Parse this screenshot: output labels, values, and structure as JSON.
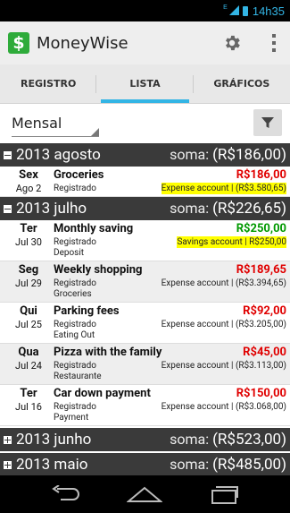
{
  "status": {
    "time": "14h35",
    "net": "E"
  },
  "app": {
    "title": "MoneyWise",
    "logo": "$"
  },
  "tabs": [
    {
      "label": "REGISTRO",
      "active": false
    },
    {
      "label": "LISTA",
      "active": true
    },
    {
      "label": "GRÁFICOS",
      "active": false
    }
  ],
  "filter": {
    "period": "Mensal"
  },
  "months": [
    {
      "title": "2013 agosto",
      "sum_label": "soma:",
      "sum": "(R$186,00)",
      "expanded": true,
      "items": [
        {
          "dow": "Sex",
          "date": "Ago 2",
          "desc": "Groceries",
          "amount": "R$186,00",
          "type": "neg",
          "status": "Registrado",
          "account": "Expense account | (R$3.580,65)",
          "highlight": true,
          "category": ""
        }
      ]
    },
    {
      "title": "2013 julho",
      "sum_label": "soma:",
      "sum": "(R$226,65)",
      "expanded": true,
      "items": [
        {
          "dow": "Ter",
          "date": "Jul 30",
          "desc": "Monthly saving",
          "amount": "R$250,00",
          "type": "pos",
          "status": "Registrado",
          "account": "Savings account | R$250,00",
          "highlight": true,
          "category": "Deposit"
        },
        {
          "dow": "Seg",
          "date": "Jul 29",
          "desc": "Weekly shopping",
          "amount": "R$189,65",
          "type": "neg",
          "status": "Registrado",
          "account": "Expense account | (R$3.394,65)",
          "highlight": false,
          "category": "Groceries"
        },
        {
          "dow": "Qui",
          "date": "Jul 25",
          "desc": "Parking fees",
          "amount": "R$92,00",
          "type": "neg",
          "status": "Registrado",
          "account": "Expense account | (R$3.205,00)",
          "highlight": false,
          "category": "Eating Out"
        },
        {
          "dow": "Qua",
          "date": "Jul 24",
          "desc": "Pizza with the family",
          "amount": "R$45,00",
          "type": "neg",
          "status": "Registrado",
          "account": "Expense account | (R$3.113,00)",
          "highlight": false,
          "category": "Restaurante"
        },
        {
          "dow": "Ter",
          "date": "Jul 16",
          "desc": "Car down payment",
          "amount": "R$150,00",
          "type": "neg",
          "status": "Registrado",
          "account": "Expense account | (R$3.068,00)",
          "highlight": false,
          "category": "Payment"
        }
      ]
    },
    {
      "title": "2013 junho",
      "sum_label": "soma:",
      "sum": "(R$523,00)",
      "expanded": false,
      "items": []
    },
    {
      "title": "2013 maio",
      "sum_label": "soma:",
      "sum": "(R$485,00)",
      "expanded": false,
      "items": []
    }
  ],
  "icons": {
    "settings": "gear-icon",
    "overflow": "overflow-menu-icon",
    "filter": "filter-funnel-icon",
    "back": "back-icon",
    "home": "home-icon",
    "recents": "recents-icon"
  },
  "colors": {
    "accent": "#33b5e5",
    "negative": "#e00000",
    "positive": "#009900",
    "highlight": "#ffff00",
    "header": "#3a3a3a"
  }
}
